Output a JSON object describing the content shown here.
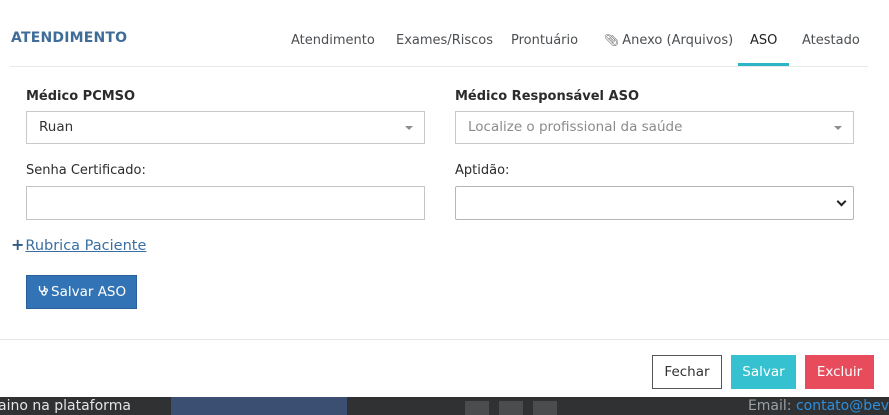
{
  "modal": {
    "title": "ATENDIMENTO",
    "tabs": [
      {
        "label": "Atendimento"
      },
      {
        "label": "Exames/Riscos"
      },
      {
        "label": "Prontuário"
      },
      {
        "label": "Anexo (Arquivos)",
        "icon": "paperclip-icon"
      },
      {
        "label": "ASO",
        "active": true
      },
      {
        "label": "Atestado"
      }
    ]
  },
  "form": {
    "medico_pcmso": {
      "label": "Médico PCMSO",
      "value": "Ruan"
    },
    "medico_responsavel": {
      "label": "Médico Responsável ASO",
      "placeholder": "Localize o profissional da saúde"
    },
    "senha_certificado": {
      "label": "Senha Certificado:",
      "value": ""
    },
    "aptidao": {
      "label": "Aptidão:",
      "value": ""
    },
    "rubrica_link": "Rubrica Paciente",
    "salvar_aso_label": "Salvar ASO"
  },
  "footer": {
    "fechar_label": "Fechar",
    "salvar_label": "Salvar",
    "excluir_label": "Excluir"
  },
  "background": {
    "left_text": "aino na plataforma",
    "right_text_prefix": "Email: ",
    "right_text_email": "contato@bev"
  },
  "colors": {
    "title": "#3f6d98",
    "tab_active_underline": "#2cb6c5",
    "primary_button": "#3273b5",
    "salvar_button": "#36c1d0",
    "excluir_button": "#e84c5c"
  }
}
